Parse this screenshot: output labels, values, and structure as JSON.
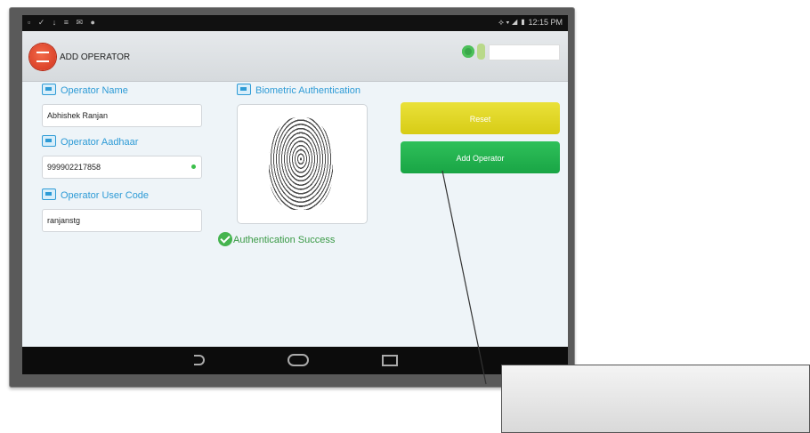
{
  "statusbar": {
    "left_icons": "▫ ✓ ↓ ≡ ✉ ●",
    "right_text": "⟡ ▾ ◢ ▮ 12:15 PM"
  },
  "app": {
    "title": "ADD OPERATOR"
  },
  "form": {
    "operator_name": {
      "label": "Operator Name",
      "value": "Abhishek Ranjan"
    },
    "operator_aadhaar": {
      "label": "Operator Aadhaar",
      "value": "999902217858"
    },
    "operator_user_code": {
      "label": "Operator User Code",
      "value": "ranjanstg"
    }
  },
  "biometric": {
    "label": "Biometric Authentication",
    "status": "Authentication Success"
  },
  "buttons": {
    "reset": "Reset",
    "add_operator": "Add Operator"
  },
  "colors": {
    "accent": "#2e9bd6",
    "reset": "#e2d92a",
    "add": "#22b04e",
    "success": "#3a9a46"
  }
}
